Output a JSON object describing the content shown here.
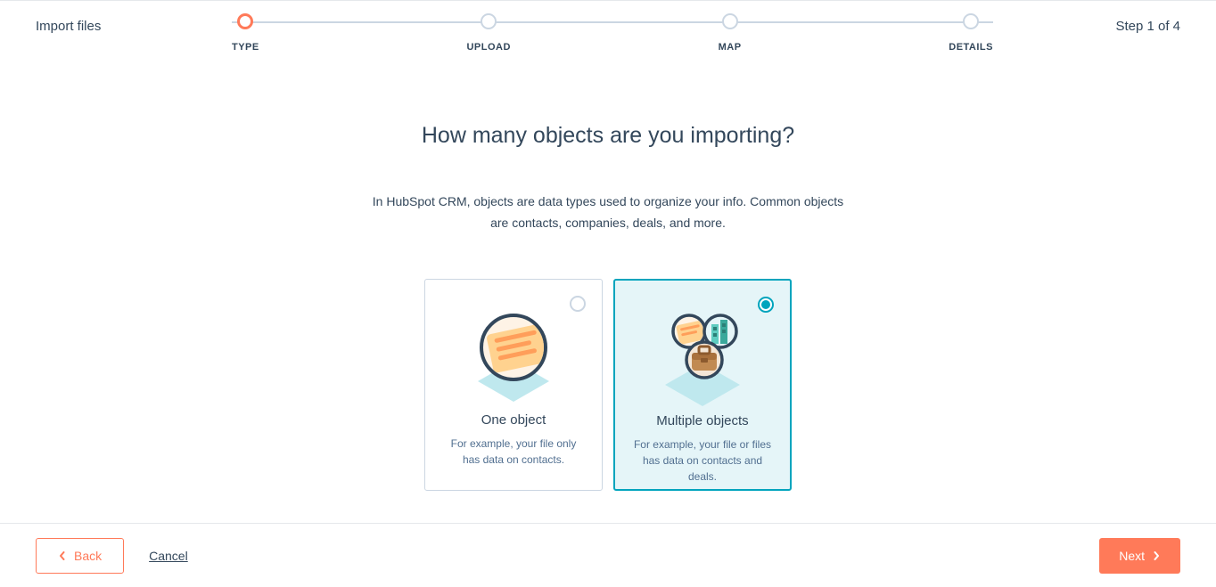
{
  "header": {
    "title": "Import files",
    "step_text": "Step 1 of 4"
  },
  "progress": {
    "steps": [
      {
        "label": "TYPE"
      },
      {
        "label": "UPLOAD"
      },
      {
        "label": "MAP"
      },
      {
        "label": "DETAILS"
      }
    ]
  },
  "main": {
    "heading": "How many objects are you importing?",
    "description": "In HubSpot CRM, objects are data types used to organize your info. Common objects are contacts, companies, deals, and more."
  },
  "cards": {
    "one": {
      "title": "One object",
      "desc": "For example, your file only has data on contacts."
    },
    "multiple": {
      "title": "Multiple objects",
      "desc": "For example, your file or files has data on contacts and deals."
    }
  },
  "footer": {
    "back": "Back",
    "cancel": "Cancel",
    "next": "Next"
  }
}
